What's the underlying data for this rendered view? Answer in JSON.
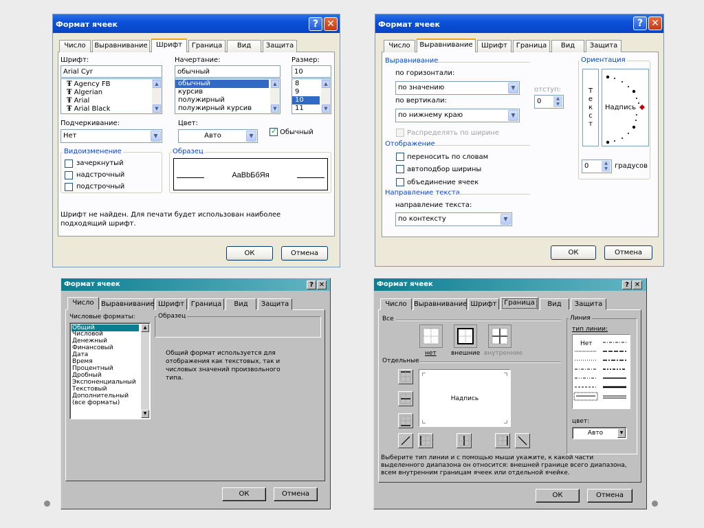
{
  "colors": {
    "xp_title": "#0a50d8",
    "classic_title": "#0b7f8f",
    "xp_face": "#ece9d8",
    "classic_face": "#c0c0c0",
    "selection": "#316ac5",
    "group_caption": "#0046d5"
  },
  "font_dialog": {
    "title": "Формат ячеек",
    "tabs": [
      "Число",
      "Выравнивание",
      "Шрифт",
      "Граница",
      "Вид",
      "Защита"
    ],
    "font": {
      "label": "Шрифт:",
      "value": "Arial Cyr",
      "list": [
        "Agency FB",
        "Algerian",
        "Arial",
        "Arial Black"
      ]
    },
    "style": {
      "label": "Начертание:",
      "value": "обычный",
      "list": [
        "обычный",
        "курсив",
        "полужирный",
        "полужирный курсив"
      ]
    },
    "size": {
      "label": "Размер:",
      "value": "10",
      "list": [
        "8",
        "9",
        "10",
        "11"
      ]
    },
    "underline": {
      "label": "Подчеркивание:",
      "value": "Нет"
    },
    "color": {
      "label": "Цвет:",
      "value": "Авто"
    },
    "normal_label": "Обычный",
    "effects": {
      "caption": "Видоизменение",
      "items": [
        "зачеркнутый",
        "надстрочный",
        "подстрочный"
      ]
    },
    "sample": {
      "caption": "Образец",
      "text": "AaBbБбЯя"
    },
    "note": "Шрифт не найден. Для печати будет использован наиболее подходящий шрифт.",
    "ok": "ОК",
    "cancel": "Отмена"
  },
  "align_dialog": {
    "title": "Формат ячеек",
    "tabs": [
      "Число",
      "Выравнивание",
      "Шрифт",
      "Граница",
      "Вид",
      "Защита"
    ],
    "alignment_caption": "Выравнивание",
    "horizontal": {
      "label": "по горизонтали:",
      "value": "по значению"
    },
    "vertical": {
      "label": "по вертикали:",
      "value": "по нижнему краю"
    },
    "indent": {
      "label": "отступ:",
      "value": "0"
    },
    "distribute": "Распределять по ширине",
    "display_caption": "Отображение",
    "display_items": [
      "переносить по словам",
      "автоподбор ширины",
      "объединение ячеек"
    ],
    "direction_caption": "Направление текста",
    "direction": {
      "label": "направление текста:",
      "value": "по контексту"
    },
    "orientation": {
      "caption": "Ориентация",
      "vertical_text": [
        "Т",
        "е",
        "к",
        "с",
        "т"
      ],
      "label": "Надпись",
      "degrees_value": "0",
      "degrees_label": "градусов"
    },
    "ok": "ОК",
    "cancel": "Отмена"
  },
  "number_dialog": {
    "title": "Формат ячеек",
    "tabs": [
      "Число",
      "Выравнивание",
      "Шрифт",
      "Граница",
      "Вид",
      "Защита"
    ],
    "formats_label": "Числовые форматы:",
    "formats": [
      "Общий",
      "Числовой",
      "Денежный",
      "Финансовый",
      "Дата",
      "Время",
      "Процентный",
      "Дробный",
      "Экспоненциальный",
      "Текстовый",
      "Дополнительный",
      "(все форматы)"
    ],
    "sample_caption": "Образец",
    "description": "Общий формат используется для отображения как текстовых, так и числовых значений произвольного типа.",
    "ok": "ОК",
    "cancel": "Отмена"
  },
  "border_dialog": {
    "title": "Формат ячеек",
    "tabs": [
      "Число",
      "Выравнивание",
      "Шрифт",
      "Граница",
      "Вид",
      "Защита"
    ],
    "all_caption": "Все",
    "presets": [
      "нет",
      "внешние",
      "внутренние"
    ],
    "separate_caption": "Отдельные",
    "preview_text": "Надпись",
    "line_caption": "Линия",
    "line_type_label": "тип линии:",
    "line_none": "Нет",
    "color_label": "цвет:",
    "color_value": "Авто",
    "hint": "Выберите тип линии и с помощью мыши укажите, к какой части выделенного диапазона он относится: внешней границе всего диапазона, всем внутренним границам ячеек или отдельной ячейке.",
    "ok": "ОК",
    "cancel": "Отмена"
  }
}
